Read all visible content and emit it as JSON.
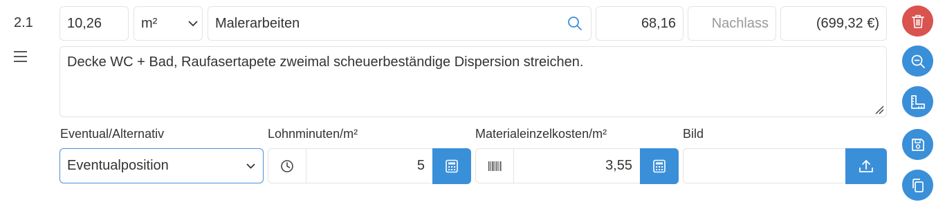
{
  "position": {
    "number": "2.1"
  },
  "row1": {
    "quantity": "10,26",
    "unit": "m²",
    "description": "Malerarbeiten",
    "unit_price": "68,16",
    "discount_placeholder": "Nachlass",
    "total": "(699,32 €)"
  },
  "text": {
    "long_description": "Decke WC + Bad, Raufasertapete zweimal scheuerbeständige Dispersion streichen."
  },
  "labels": {
    "type": "Eventual/Alternativ",
    "labor_minutes": "Lohnminuten/m²",
    "material_costs": "Materialeinzelkosten/m²",
    "image": "Bild"
  },
  "row3": {
    "type_value": "Eventualposition",
    "labor_minutes_value": "5",
    "material_costs_value": "3,55"
  },
  "icons": {
    "delete": "trash-icon",
    "zoom": "zoom-out-icon",
    "measure": "ruler-icon",
    "save": "save-icon",
    "copy": "copy-icon",
    "search": "search-icon",
    "clock": "clock-icon",
    "barcode": "barcode-icon",
    "calculator": "calculator-icon",
    "upload": "upload-icon",
    "menu": "hamburger-icon"
  },
  "colors": {
    "primary": "#3a8fd9",
    "danger": "#d9534f",
    "border": "#e3e3e3",
    "focus_border": "#4a90d9"
  }
}
